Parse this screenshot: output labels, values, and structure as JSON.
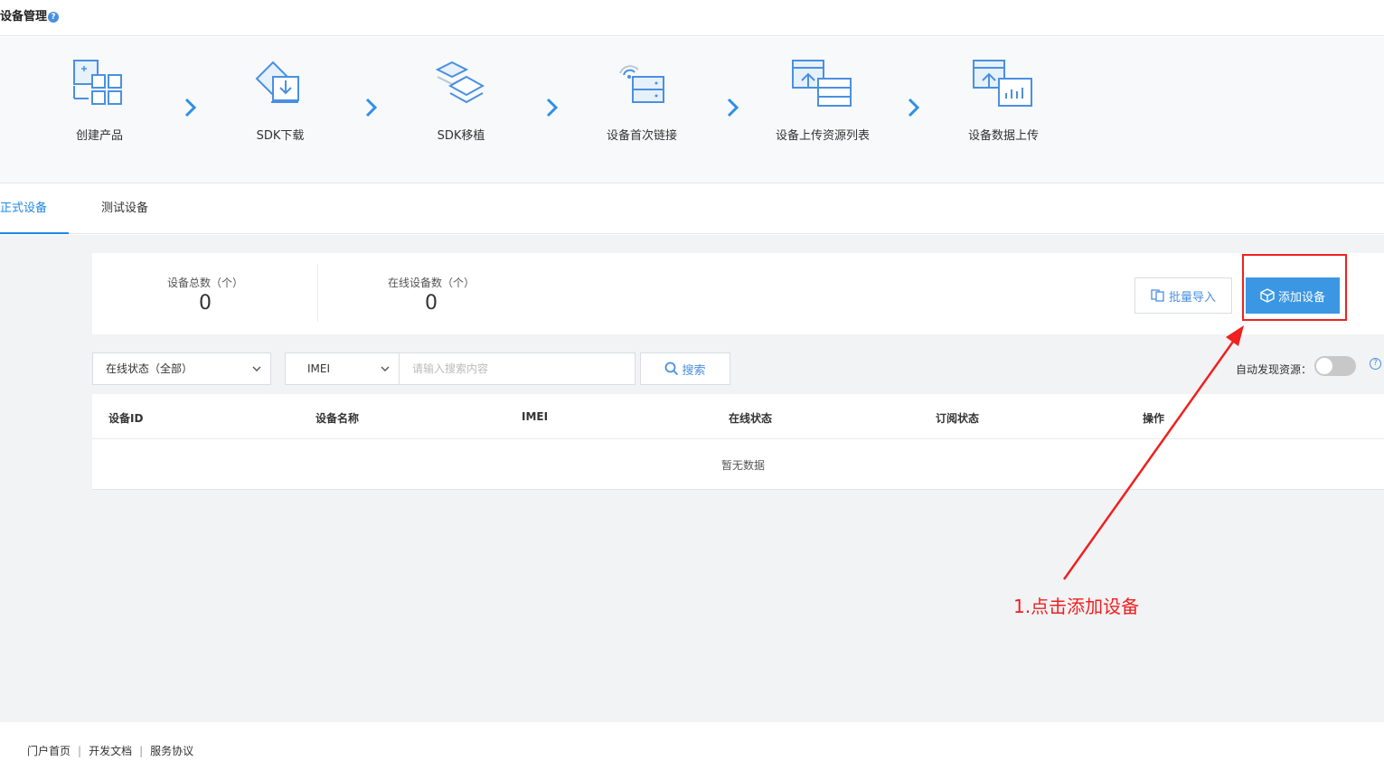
{
  "page": {
    "title": "设备管理",
    "help_symbol": "?"
  },
  "steps": [
    {
      "label": "创建产品",
      "icon": "create-product-icon"
    },
    {
      "label": "SDK下载",
      "icon": "sdk-download-icon"
    },
    {
      "label": "SDK移植",
      "icon": "sdk-port-icon"
    },
    {
      "label": "设备首次链接",
      "icon": "device-connect-icon"
    },
    {
      "label": "设备上传资源列表",
      "icon": "upload-resource-list-icon"
    },
    {
      "label": "设备数据上传",
      "icon": "upload-data-icon"
    }
  ],
  "tabs": [
    {
      "label": "正式设备",
      "active": true
    },
    {
      "label": "测试设备",
      "active": false
    }
  ],
  "stats": {
    "total_label": "设备总数（个）",
    "total_value": "0",
    "online_label": "在线设备数（个）",
    "online_value": "0"
  },
  "actions": {
    "batch_import": "批量导入",
    "add_device": "添加设备"
  },
  "filters": {
    "status_select": "在线状态（全部）",
    "field_select": "IMEI",
    "search_placeholder": "请输入搜索内容",
    "search_button": "搜索",
    "auto_discover_label": "自动发现资源：",
    "auto_discover_on": false
  },
  "table": {
    "columns": [
      "设备ID",
      "设备名称",
      "IMEI",
      "在线状态",
      "订阅状态",
      "操作"
    ],
    "empty_text": "暂无数据"
  },
  "annotation": {
    "text": "1.点击添加设备"
  },
  "footer": {
    "links": [
      "门户首页",
      "开发文档",
      "服务协议"
    ]
  },
  "colors": {
    "accent": "#3b97e3",
    "annotation": "#f02020"
  }
}
